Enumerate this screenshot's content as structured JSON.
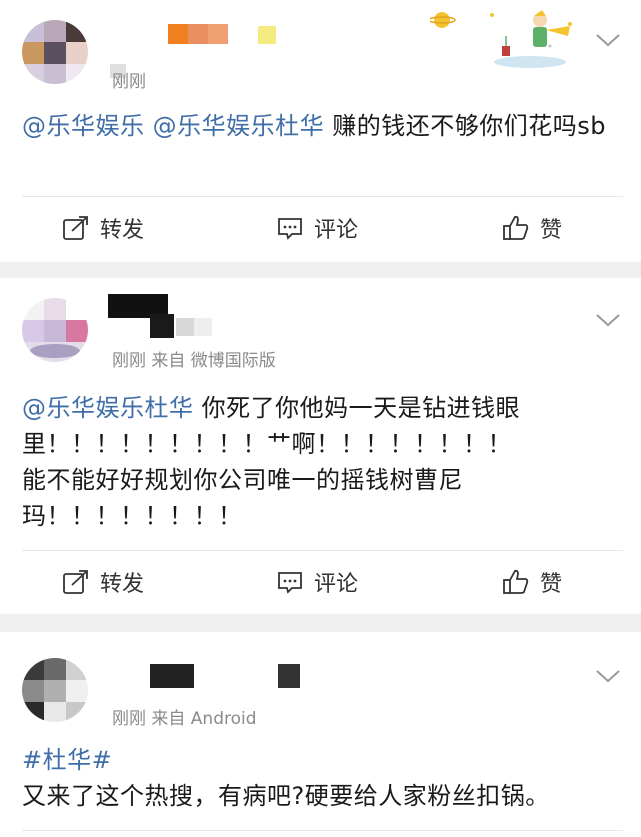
{
  "posts": [
    {
      "meta": "刚刚",
      "mentions": [
        "@乐华娱乐",
        "@乐华娱乐杜华"
      ],
      "text": " 赚的钱还不够你们花吗sb"
    },
    {
      "meta": "刚刚  来自 微博国际版",
      "mentions": [
        "@乐华娱乐杜华"
      ],
      "line1_text": " 你死了你他妈一天是钻进钱眼",
      "line2": "里！！！！！！！！！艹啊！！！！！！！！",
      "line3": "能不能好好规划你公司唯一的摇钱树曹尼",
      "line4": "玛！！！！！！！！"
    },
    {
      "meta": "刚刚  来自 Android",
      "hashtag": "#杜华#",
      "text": "又来了这个热搜，有病吧?硬要给人家粉丝扣锅。"
    }
  ],
  "actions": {
    "repost": "转发",
    "comment": "评论",
    "like": "赞"
  },
  "icons": {
    "expand": "chevron-down-icon",
    "repost": "repost-icon",
    "comment": "comment-icon",
    "like": "thumbs-up-icon"
  },
  "colors": {
    "link": "#3f6ea8",
    "text": "#1a1a1a",
    "meta": "#8a8a8a",
    "separator": "#efefef"
  }
}
